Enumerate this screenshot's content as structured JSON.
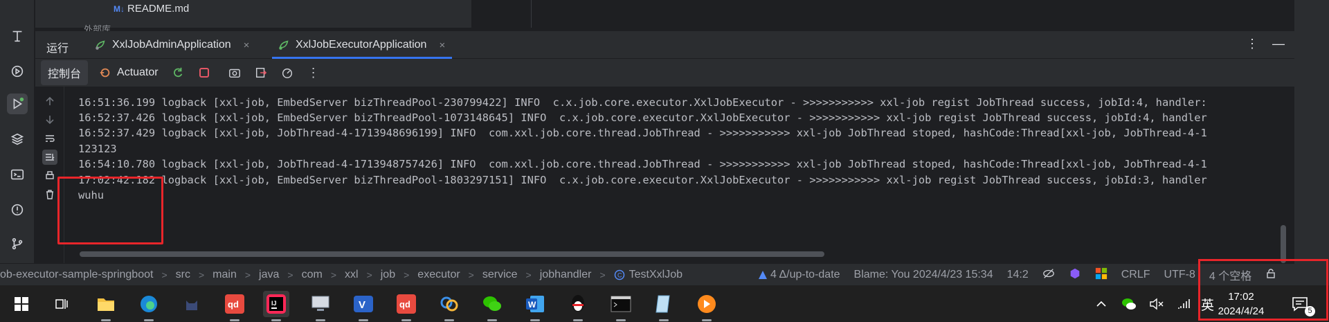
{
  "tree": {
    "file_badge": "M↓",
    "file_name": "README.md",
    "partial_row": "外部库"
  },
  "run_panel": {
    "label": "运行",
    "tabs": [
      {
        "label": "XxlJobAdminApplication",
        "close": "×",
        "active": false
      },
      {
        "label": "XxlJobExecutorApplication",
        "close": "×",
        "active": true
      }
    ],
    "console_tab": "控制台",
    "actuator_tab": "Actuator",
    "more_icon": "⋮",
    "minimize_icon": "—"
  },
  "console": {
    "lines": [
      "16:51:36.199 logback [xxl-job, EmbedServer bizThreadPool-230799422] INFO  c.x.job.core.executor.XxlJobExecutor - >>>>>>>>>>> xxl-job regist JobThread success, jobId:4, handler:",
      "16:52:37.426 logback [xxl-job, EmbedServer bizThreadPool-1073148645] INFO  c.x.job.core.executor.XxlJobExecutor - >>>>>>>>>>> xxl-job regist JobThread success, jobId:4, handler",
      "16:52:37.429 logback [xxl-job, JobThread-4-1713948696199] INFO  com.xxl.job.core.thread.JobThread - >>>>>>>>>>> xxl-job JobThread stoped, hashCode:Thread[xxl-job, JobThread-4-1",
      "123123",
      "16:54:10.780 logback [xxl-job, JobThread-4-1713948757426] INFO  com.xxl.job.core.thread.JobThread - >>>>>>>>>>> xxl-job JobThread stoped, hashCode:Thread[xxl-job, JobThread-4-1",
      "17:02:42.182 logback [xxl-job, EmbedServer bizThreadPool-1803297151] INFO  c.x.job.core.executor.XxlJobExecutor - >>>>>>>>>>> xxl-job regist JobThread success, jobId:3, handler",
      "wuhu"
    ]
  },
  "statusbar": {
    "breadcrumbs": [
      "ob-executor-sample-springboot",
      "src",
      "main",
      "java",
      "com",
      "xxl",
      "job",
      "executor",
      "service",
      "jobhandler"
    ],
    "class_name": "TestXxlJob",
    "separator": ">",
    "vcs": "4 Δ/up-to-date",
    "blame": "Blame: You 2024/4/23 15:34",
    "position": "14:2",
    "line_sep": "CRLF",
    "encoding": "UTF-8",
    "indent": "4 个空格"
  },
  "taskbar": {
    "ime": "英",
    "time": "17:02",
    "date": "2024/4/24",
    "notifications": "5"
  },
  "colors": {
    "accent": "#3574f0",
    "highlight_box": "#e8252a",
    "panel": "#2b2d30",
    "editor": "#1e1f22"
  }
}
